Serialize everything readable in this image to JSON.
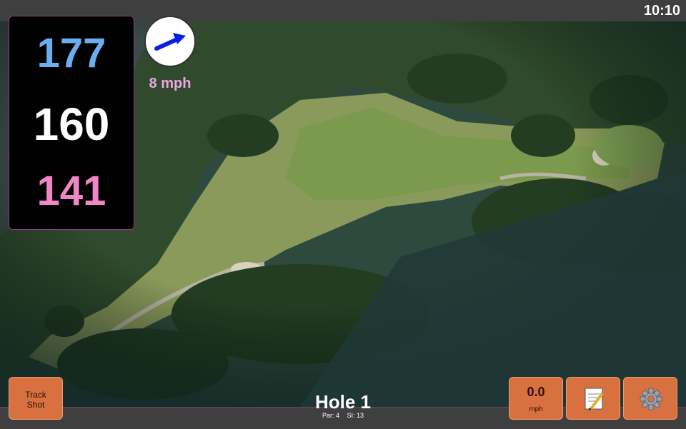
{
  "status": {
    "time": "10:10"
  },
  "distances": {
    "back": "177",
    "middle": "160",
    "front": "141"
  },
  "wind": {
    "speed_label": "8 mph",
    "arrow_color": "#0a1ee6",
    "icon": "wind-arrow-icon"
  },
  "buttons": {
    "track_shot_line1": "Track",
    "track_shot_line2": "Shot",
    "speed_value": "0.0",
    "speed_unit": "mph",
    "notes_icon": "notepad-icon",
    "settings_icon": "gear-icon"
  },
  "hole": {
    "title": "Hole 1",
    "par_label": "Par: 4",
    "si_label": "SI: 13"
  },
  "colors": {
    "back_distance": "#6aaef0",
    "middle_distance": "#ffffff",
    "front_distance": "#ef86c6",
    "button": "#d9703f",
    "accent_border": "#8a3f87"
  }
}
